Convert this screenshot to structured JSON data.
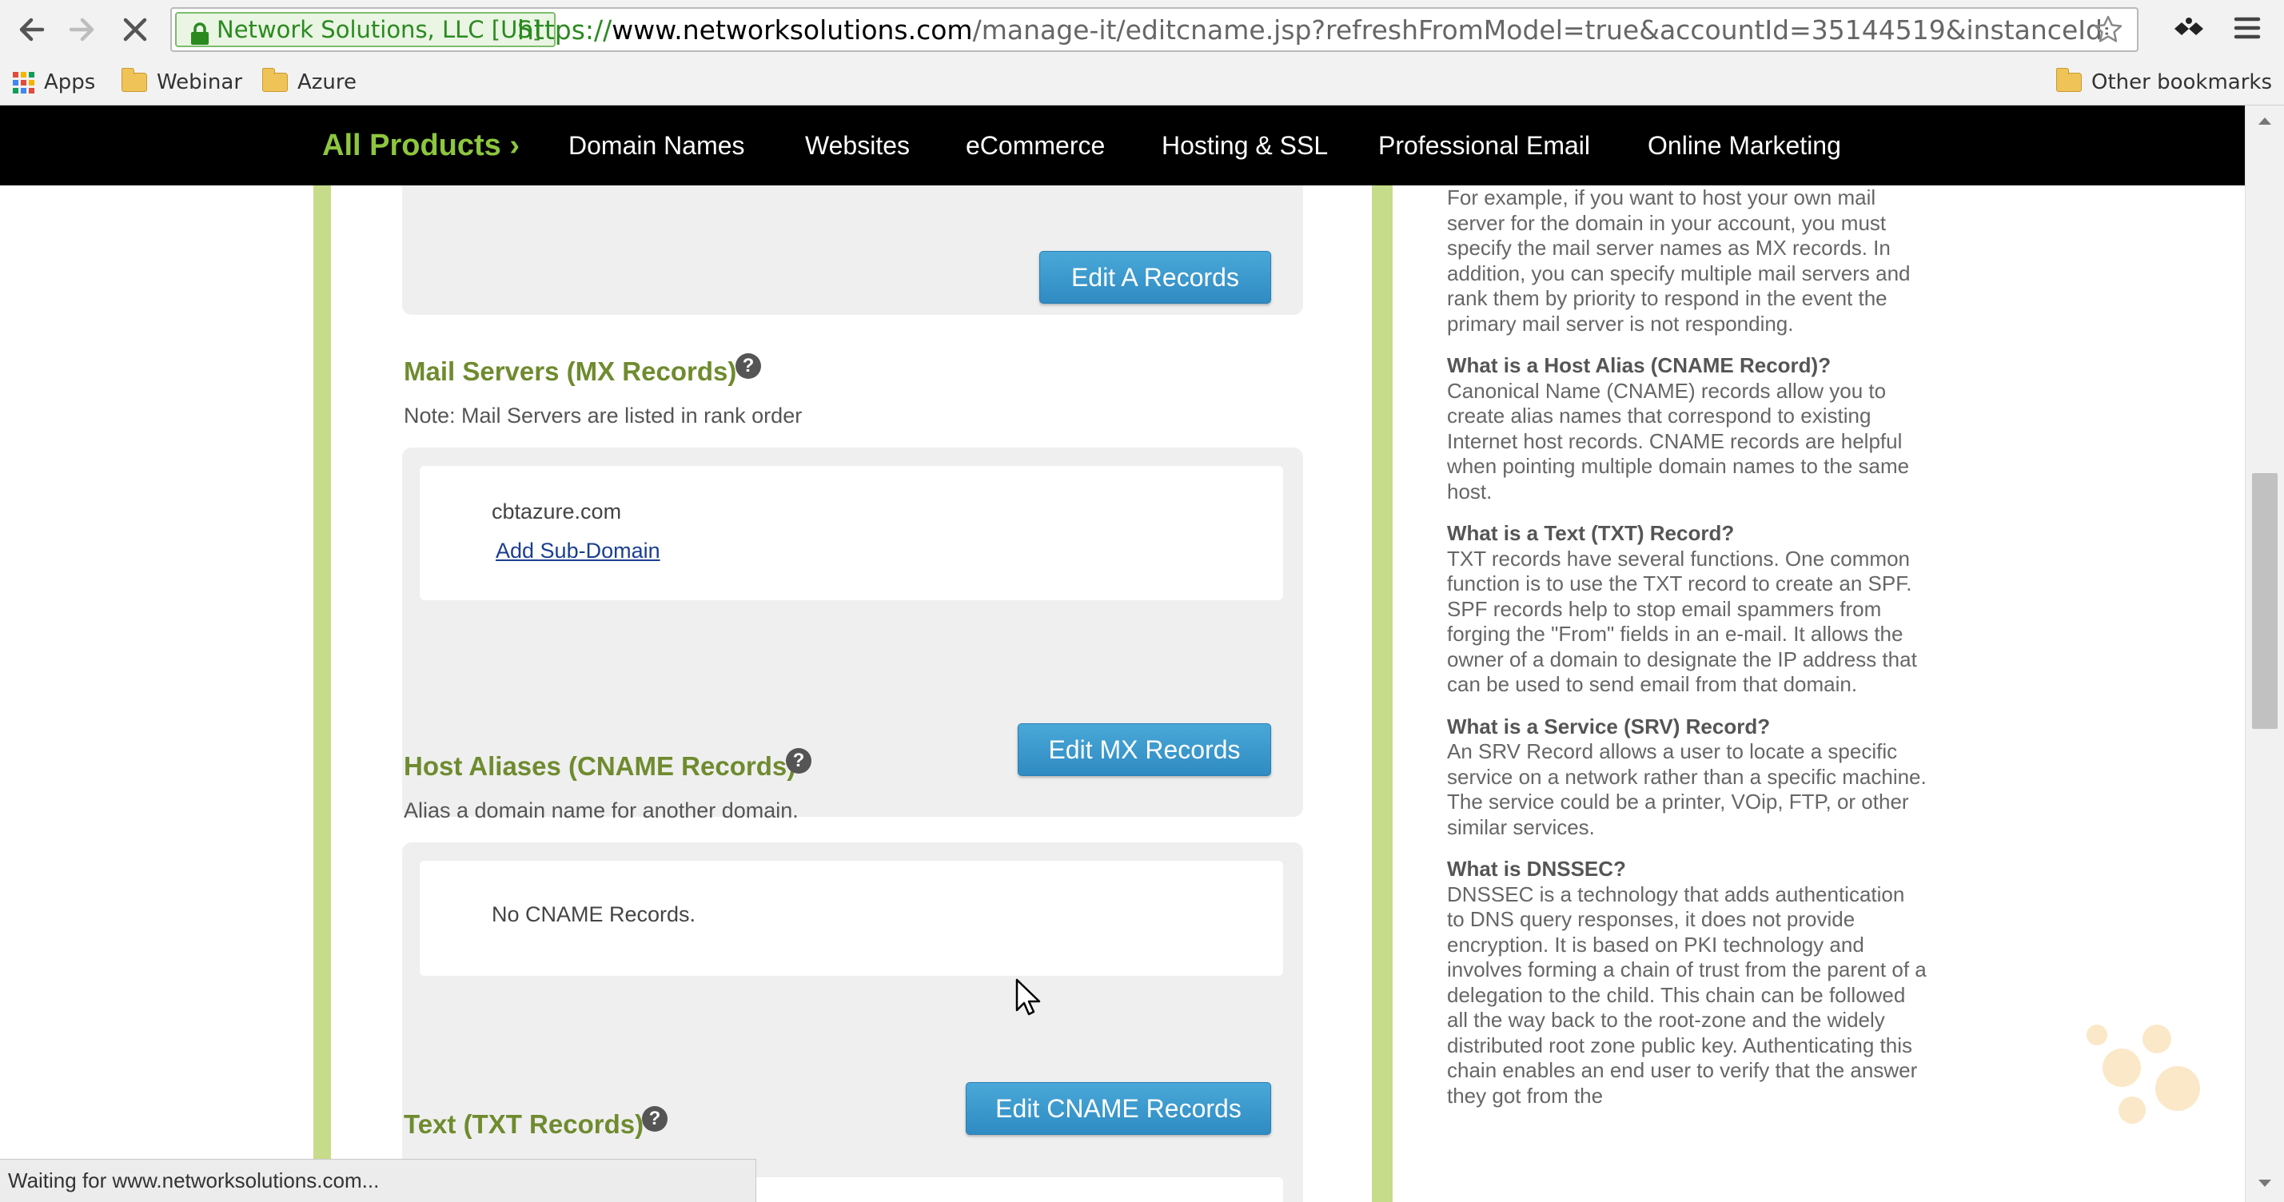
{
  "browser": {
    "ev_badge": "Network Solutions, LLC [US]",
    "url_scheme": "https://",
    "url_host": "www.networksolutions.com",
    "url_path": "/manage-it/editcname.jsp?refreshFromModel=true&accountId=35144519&instanceId=WN",
    "bookmarks": [
      {
        "label": "Apps",
        "icon": "apps-grid-icon"
      },
      {
        "label": "Webinar",
        "icon": "folder-icon"
      },
      {
        "label": "Azure",
        "icon": "folder-icon"
      }
    ],
    "other_bookmarks": "Other bookmarks",
    "status_text": "Waiting for www.networksolutions.com..."
  },
  "nav": {
    "all_products": "All Products ›",
    "items": [
      "Domain Names",
      "Websites",
      "eCommerce",
      "Hosting & SSL",
      "Professional Email",
      "Online Marketing"
    ]
  },
  "sections": {
    "a_records": {
      "button": "Edit A Records"
    },
    "mx": {
      "title": "Mail Servers (MX Records)",
      "note": "Note: Mail Servers are listed in rank order",
      "value": "cbtazure.com",
      "link": "Add Sub-Domain",
      "button": "Edit MX Records"
    },
    "cname": {
      "title": "Host Aliases (CNAME Records)",
      "note": "Alias a domain name for another domain.",
      "value": "No CNAME Records.",
      "button": "Edit CNAME Records"
    },
    "txt": {
      "title": "Text (TXT Records)"
    }
  },
  "help": {
    "mx_text": "For example, if you want to host your own mail server for the domain in your account, you must specify the mail server names as MX records. In addition, you can specify multiple mail servers and rank them by priority to respond in the event the primary mail server is not responding.",
    "cname_q": "What is a Host Alias (CNAME Record)?",
    "cname_a": "Canonical Name (CNAME) records allow you to create alias names that correspond to existing Internet host records. CNAME records are helpful when pointing multiple domain names to the same host.",
    "txt_q": "What is a Text (TXT) Record?",
    "txt_a": "TXT records have several functions. One common function is to use the TXT record to create an SPF.  SPF records help to stop email spammers from forging the \"From\" fields in an e-mail. It allows the owner of a domain to designate the IP address that can be used to send email from that domain.",
    "srv_q": "What is a Service (SRV) Record?",
    "srv_a": "An SRV Record allows a user to locate a specific service on a network rather than a specific machine.  The service could be a printer, VOip, FTP, or other similar services.",
    "dnssec_q": "What is DNSSEC?",
    "dnssec_a": "DNSSEC is a technology that adds authentication to DNS query responses, it does not provide encryption. It is based on PKI technology and involves forming a chain of trust from the parent of a delegation to the child. This chain can be followed all the way back to the root-zone and the widely distributed root zone public key. Authenticating this chain enables an end user to verify that the answer they got from the"
  },
  "colors": {
    "nav_bg": "#000000",
    "brand_green": "#8dc63f",
    "section_title": "#6f8b2f",
    "button_blue": "#3596cc",
    "side_bar_green": "#c6dc8a"
  }
}
